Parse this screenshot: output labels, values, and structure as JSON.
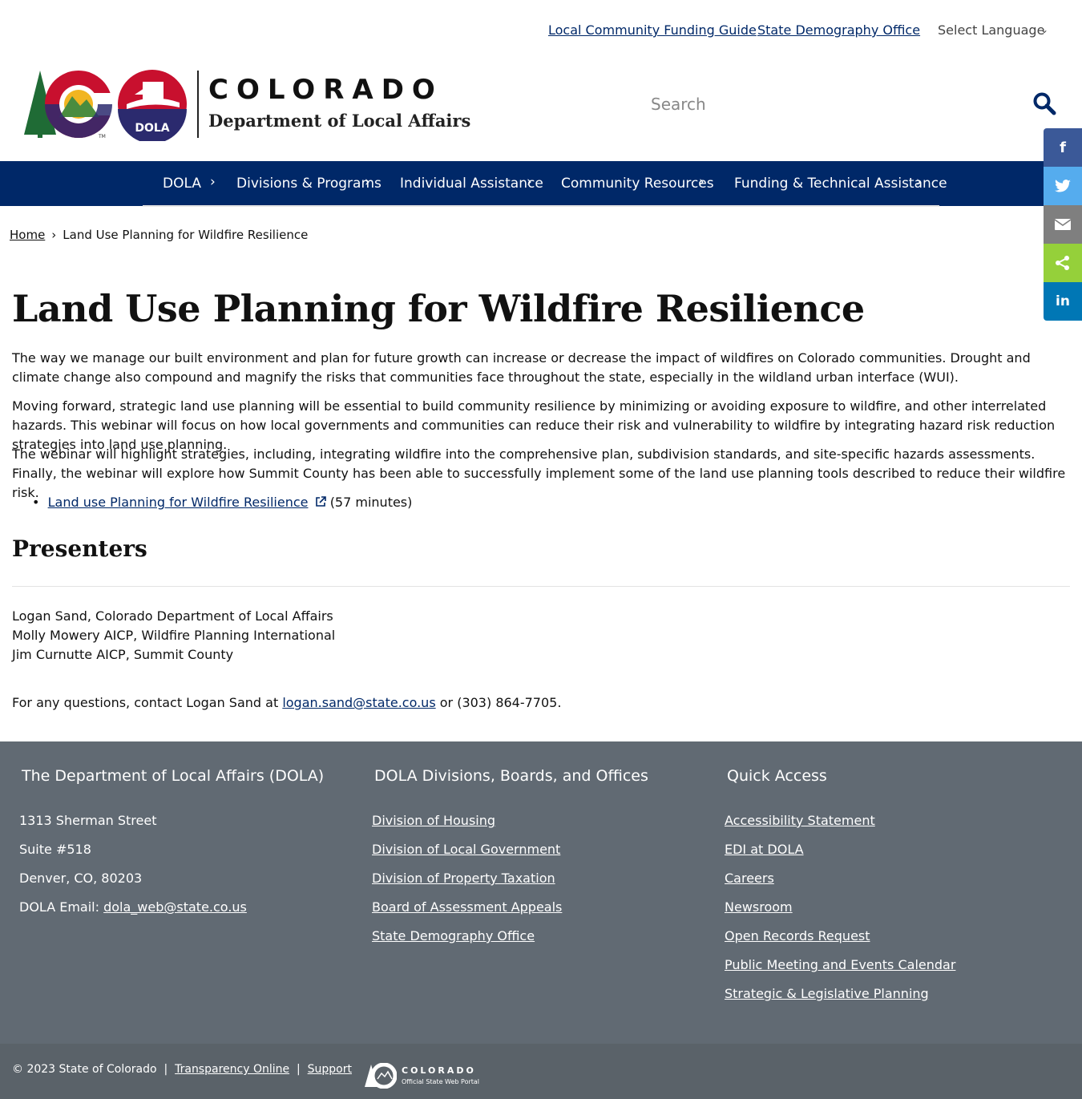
{
  "utility": {
    "links": [
      "Local Community Funding Guide",
      "State Demography Office"
    ],
    "language": "Select Language"
  },
  "logo": {
    "state": "COLORADO",
    "department": "Department of Local Affairs",
    "badge": "DOLA",
    "tm": "TM"
  },
  "search": {
    "placeholder": "Search"
  },
  "nav": {
    "items": [
      "DOLA",
      "Divisions & Programs",
      "Individual Assistance",
      "Community Resources",
      "Funding & Technical Assistance"
    ]
  },
  "share": {
    "facebook": "f",
    "linkedin": "in"
  },
  "breadcrumb": {
    "home": "Home",
    "current": "Land Use Planning for Wildfire Resilience"
  },
  "main": {
    "title": "Land Use Planning for Wildfire Resilience",
    "paragraphs": [
      "The way we manage our built environment and plan for future growth can increase or decrease the impact of wildfires on Colorado communities. Drought and climate change also compound and magnify the risks that communities face throughout the state, especially in the wildland urban interface (WUI).",
      "Moving forward, strategic land use planning will be essential to build community resilience by minimizing or avoiding exposure to wildfire, and other interrelated hazards. This webinar will focus on how local governments and communities can reduce their risk and vulnerability to wildfire by integrating hazard risk reduction strategies into land use planning.",
      "The webinar will highlight strategies, including, integrating wildfire into the comprehensive plan, subdivision standards, and site-specific hazards assessments. Finally, the webinar will explore how Summit County has been able to successfully implement some of the land use planning tools described to reduce their wildfire risk."
    ],
    "webinar_link": "Land use Planning for Wildfire Resilience",
    "webinar_duration": "(57 minutes)",
    "presenters_heading": "Presenters",
    "presenters": [
      "Logan Sand, Colorado Department of Local Affairs",
      "Molly Mowery AICP, Wildfire Planning International",
      "Jim Curnutte AICP, Summit County"
    ],
    "contact_prefix": "For any questions, contact Logan Sand at",
    "contact_email": "logan.sand@state.co.us",
    "contact_suffix": "or (303) 864-7705."
  },
  "footer": {
    "col1_heading": "The Department of Local Affairs (DOLA)",
    "address": [
      "1313 Sherman Street",
      "Suite  #518",
      "Denver, CO, 80203"
    ],
    "email_label": "DOLA Email:",
    "email": "dola_web@state.co.us",
    "col2_heading": "DOLA Divisions, Boards, and Offices",
    "divisions": [
      "Division of Housing",
      "Division of Local Government",
      "Division of Property Taxation",
      "Board of Assessment Appeals",
      "State Demography Office"
    ],
    "col3_heading": "Quick Access",
    "quick_access": [
      "Accessibility Statement",
      "EDI at DOLA",
      "Careers",
      "Newsroom",
      "Open Records Request",
      "Public Meeting and Events Calendar",
      "Strategic & Legislative Planning"
    ],
    "copyright": "© 2023 State of Colorado",
    "bottom_links": [
      "Transparency Online",
      "Support"
    ],
    "portal_state": "COLORADO",
    "portal_sub": "Official State Web Portal"
  },
  "colors": {
    "primary_navy": "#002868",
    "footer_gray": "#616a73",
    "facebook": "#3b5998",
    "twitter": "#55acee",
    "email": "#7f7f7f",
    "sharethis": "#95d03a",
    "linkedin": "#0077b5"
  }
}
